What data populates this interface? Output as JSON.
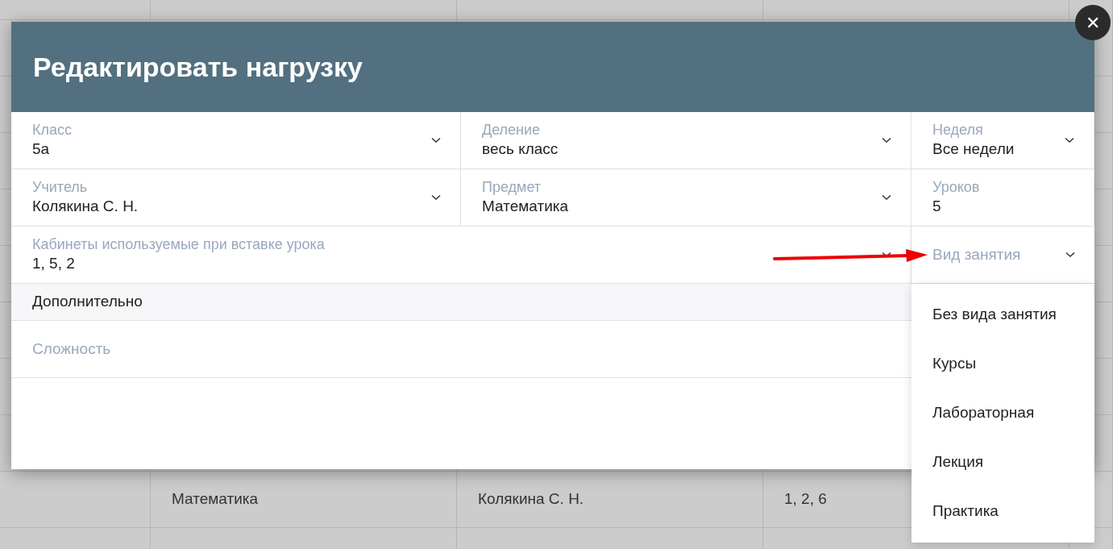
{
  "background_table": {
    "rows": [
      [
        "",
        "Математика",
        "Колякина С. Н.",
        "1, 2, 6",
        ""
      ]
    ]
  },
  "dialog": {
    "title": "Редактировать нагрузку",
    "close_label": "✕",
    "field_rows": [
      [
        {
          "label": "Класс",
          "value": "5а",
          "kind": "dropdown"
        },
        {
          "label": "Деление",
          "value": "весь класс",
          "kind": "dropdown"
        },
        {
          "label": "Неделя",
          "value": "Все недели",
          "kind": "dropdown"
        }
      ],
      [
        {
          "label": "Учитель",
          "value": "Колякина С. Н.",
          "kind": "dropdown"
        },
        {
          "label": "Предмет",
          "value": "Математика",
          "kind": "dropdown"
        },
        {
          "label": "Уроков",
          "value": "5",
          "kind": "text"
        }
      ],
      [
        {
          "label": "Кабинеты используемые при вставке урока",
          "value": "1, 5, 2",
          "kind": "dropdown"
        },
        {
          "label": "Вид занятия",
          "kind": "dropdown",
          "expanded": true,
          "options": [
            "Без вида занятия",
            "Курсы",
            "Лабораторная",
            "Лекция",
            "Практика"
          ]
        }
      ]
    ],
    "section": "Дополнительно",
    "extra_field": {
      "label": "Сложность"
    }
  }
}
